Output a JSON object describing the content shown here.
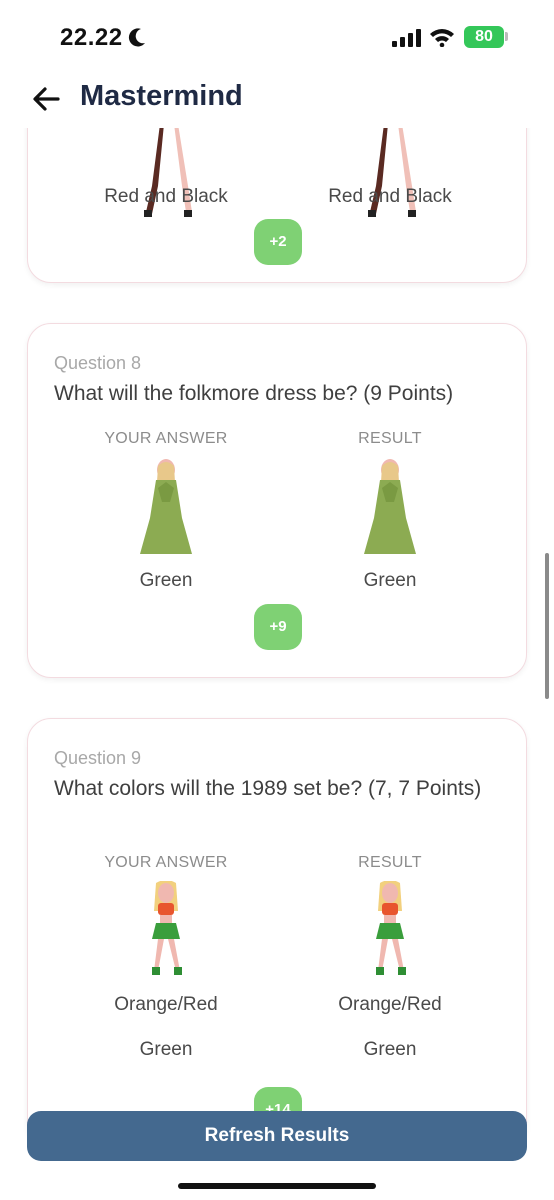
{
  "status_bar": {
    "time": "22.22",
    "battery": "80"
  },
  "header": {
    "title": "Mastermind"
  },
  "columns": {
    "your_answer": "YOUR ANSWER",
    "result": "RESULT"
  },
  "questions": [
    {
      "answer": [
        "Red and Black"
      ],
      "result": [
        "Red and Black"
      ],
      "points": "+2"
    },
    {
      "number": "Question 8",
      "text": "What will the folkmore dress be? (9 Points)",
      "answer": [
        "Green"
      ],
      "result": [
        "Green"
      ],
      "points": "+9",
      "figure": "green-dress-figure-icon"
    },
    {
      "number": "Question 9",
      "text": "What colors will the 1989 set be? (7, 7 Points)",
      "answer": [
        "Orange/Red",
        "Green"
      ],
      "result": [
        "Orange/Red",
        "Green"
      ],
      "points": "+14",
      "figure": "two-piece-outfit-figure-icon"
    }
  ],
  "actions": {
    "refresh_label": "Refresh Results"
  },
  "colors": {
    "accent_green": "#7fd174",
    "button_blue": "#44698f",
    "title_navy": "#1f2a44"
  }
}
